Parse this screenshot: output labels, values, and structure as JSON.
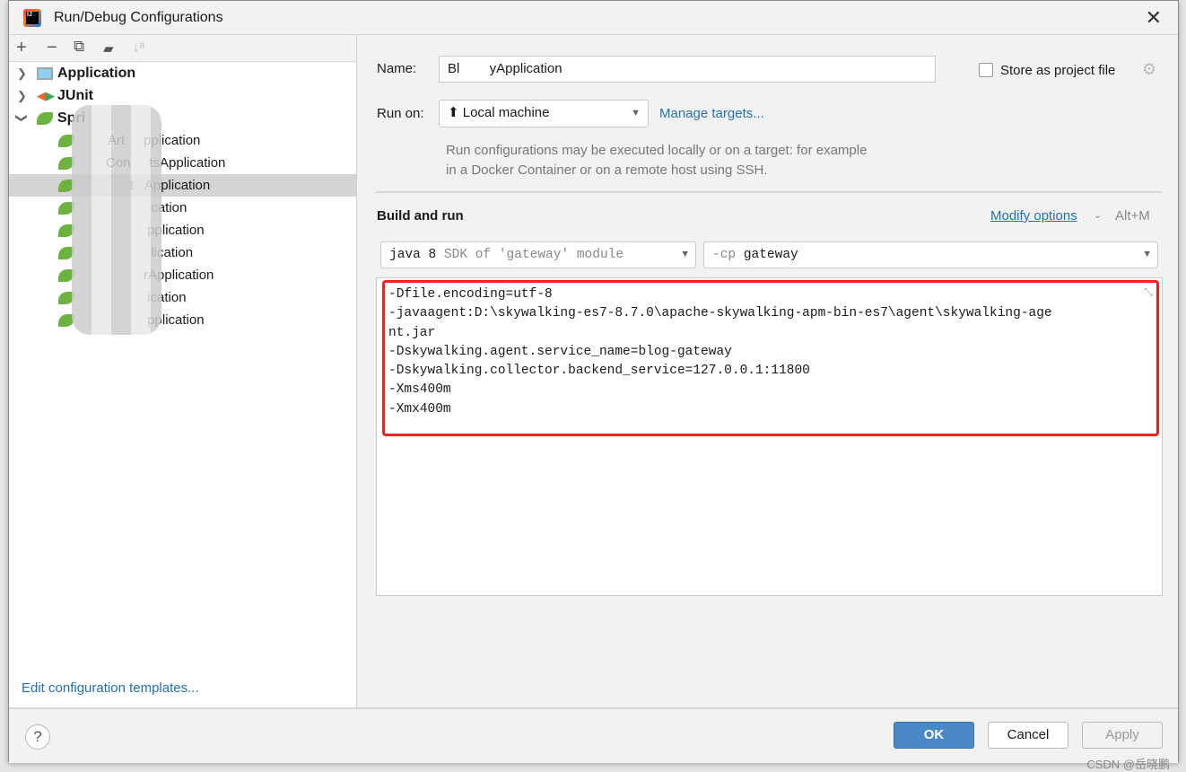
{
  "window": {
    "title": "Run/Debug Configurations",
    "close": "✕"
  },
  "toolbar": {
    "add": "+",
    "remove": "−",
    "copy": "⧉",
    "folder": "▰",
    "sort": "↓ᵃ"
  },
  "tree": {
    "groups": [
      {
        "label": "Application",
        "icon": "application-icon"
      },
      {
        "label": "JUnit",
        "icon": "junit-icon"
      },
      {
        "label": "Spri",
        "icon": "spring-boot-icon"
      }
    ],
    "items": [
      "Art     pplication",
      "Con     tsApplication",
      "      t   Application",
      "              cation",
      "             pplication",
      "              lication",
      "            rApplication",
      "             ication",
      "             pplication"
    ],
    "selected_index": 2
  },
  "left": {
    "edit_templates": "Edit configuration templates..."
  },
  "form": {
    "name_label": "Name:",
    "name_value": "Bl        yApplication",
    "store_label": "Store as project file",
    "store_checked": false,
    "run_on_label": "Run on:",
    "run_on_value": "Local machine",
    "manage_targets": "Manage targets...",
    "hint": "Run configurations may be executed locally or on a target: for example in a Docker Container or on a remote host using SSH.",
    "section": "Build and run",
    "modify_options": "Modify options",
    "modify_shortcut": "Alt+M",
    "jre_main": "java 8",
    "jre_sub": "SDK of 'gateway' module",
    "cp_prefix": "-cp",
    "cp_value": "gateway",
    "vm_options": "-Dfile.encoding=utf-8\n-javaagent:D:\\skywalking-es7-8.7.0\\apache-skywalking-apm-bin-es7\\agent\\skywalking-age\nnt.jar\n-Dskywalking.agent.service_name=blog-gateway\n-Dskywalking.collector.backend_service=127.0.0.1:11800\n-Xms400m\n-Xmx400m"
  },
  "buttons": {
    "help": "?",
    "ok": "OK",
    "cancel": "Cancel",
    "apply": "Apply"
  },
  "watermark": "CSDN @岳晓鹏",
  "colors": {
    "accent": "#4a88c7",
    "link": "#2470b3",
    "highlight": "#e8241f"
  }
}
